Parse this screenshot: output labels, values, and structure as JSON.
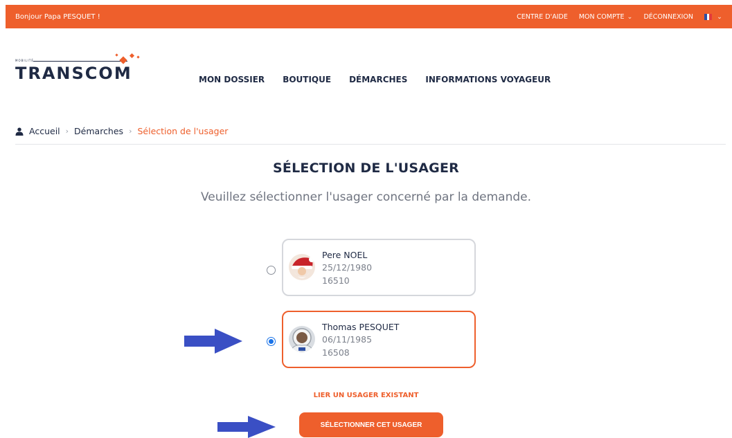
{
  "topbar": {
    "greeting": "Bonjour Papa PESQUET !",
    "help": "CENTRE D'AIDE",
    "account": "MON COMPTE",
    "logout": "DÉCONNEXION",
    "language_flag": "fr-flag-icon"
  },
  "brand": {
    "logo_text": "TRANSCOM",
    "logo_small": "MOBILITÉ"
  },
  "nav": {
    "items": [
      {
        "label": "MON DOSSIER"
      },
      {
        "label": "BOUTIQUE"
      },
      {
        "label": "DÉMARCHES"
      },
      {
        "label": "INFORMATIONS VOYAGEUR"
      }
    ]
  },
  "breadcrumb": {
    "home": "Accueil",
    "step": "Démarches",
    "current": "Sélection de l'usager"
  },
  "page": {
    "title": "SÉLECTION DE L'USAGER",
    "subtitle": "Veuillez sélectionner l'usager concerné par la demande."
  },
  "users": [
    {
      "name": "Pere NOEL",
      "birthdate": "25/12/1980",
      "number": "16510",
      "selected": false
    },
    {
      "name": "Thomas PESQUET",
      "birthdate": "06/11/1985",
      "number": "16508",
      "selected": true
    }
  ],
  "actions": {
    "link_existing": "LIER UN USAGER EXISTANT",
    "select_button": "SÉLECTIONNER CET USAGER"
  },
  "colors": {
    "accent": "#ee5f2c",
    "navy": "#1f2a44",
    "annotation_arrow": "#3a4fc4"
  }
}
